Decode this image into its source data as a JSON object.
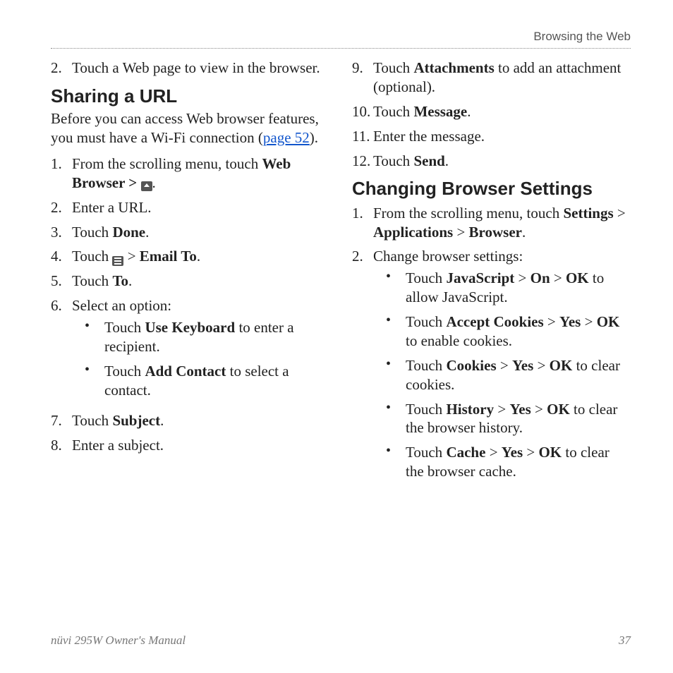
{
  "header": {
    "section": "Browsing the Web"
  },
  "footer": {
    "left": "nüvi 295W Owner's Manual",
    "right": "37"
  },
  "left_col": {
    "lead_item": {
      "n": "2.",
      "text": "Touch a Web page to view in the browser."
    },
    "h_share": "Sharing a URL",
    "share_intro_pre": "Before you can access Web browser features, you must have a Wi-Fi connection (",
    "share_intro_link": "page 52",
    "share_intro_post": ").",
    "steps": [
      {
        "n": "1.",
        "pre": "From the scrolling menu, touch ",
        "b1": "Web Browser > ",
        "icon": "home",
        "post": "."
      },
      {
        "n": "2.",
        "text": "Enter a URL."
      },
      {
        "n": "3.",
        "pre": "Touch ",
        "b1": "Done",
        "post": "."
      },
      {
        "n": "4.",
        "pre": "Touch ",
        "icon": "menu",
        "mid": " > ",
        "b1": "Email To",
        "post": "."
      },
      {
        "n": "5.",
        "pre": "Touch ",
        "b1": "To",
        "post": "."
      },
      {
        "n": "6.",
        "text": "Select an option:",
        "sub": [
          {
            "pre": "Touch ",
            "b1": "Use Keyboard",
            "post": " to enter a recipient."
          },
          {
            "pre": "Touch ",
            "b1": "Add Contact",
            "post": " to select a contact."
          }
        ]
      },
      {
        "n": "7.",
        "pre": "Touch ",
        "b1": "Subject",
        "post": "."
      },
      {
        "n": "8.",
        "text": "Enter a subject."
      }
    ]
  },
  "right_col": {
    "steps_a": [
      {
        "n": "9.",
        "pre": "Touch ",
        "b1": "Attachments",
        "post": " to add an attachment (optional)."
      },
      {
        "n": "10.",
        "pre": "Touch ",
        "b1": "Message",
        "post": "."
      },
      {
        "n": "11.",
        "text": "Enter the message."
      },
      {
        "n": "12.",
        "pre": "Touch ",
        "b1": "Send",
        "post": "."
      }
    ],
    "h_change": "Changing Browser Settings",
    "steps_b": [
      {
        "n": "1.",
        "pre": "From the scrolling menu, touch ",
        "b1": "Settings",
        "m1": " > ",
        "b2": "Applications",
        "m2": " > ",
        "b3": "Browser",
        "post": "."
      },
      {
        "n": "2.",
        "text": "Change browser settings:",
        "sub": [
          {
            "pre": "Touch ",
            "b1": "JavaScript",
            "m1": " > ",
            "b2": "On",
            "m2": " > ",
            "b3": "OK",
            "post": " to allow JavaScript."
          },
          {
            "pre": "Touch ",
            "b1": "Accept Cookies",
            "m1": " > ",
            "b2": "Yes",
            "m2": " > ",
            "b3": "OK",
            "post": " to enable cookies."
          },
          {
            "pre": "Touch ",
            "b1": "Cookies",
            "m1": " > ",
            "b2": "Yes",
            "m2": " > ",
            "b3": "OK",
            "post": " to clear cookies."
          },
          {
            "pre": "Touch ",
            "b1": "History",
            "m1": " > ",
            "b2": "Yes",
            "m2": " > ",
            "b3": "OK",
            "post": " to clear the browser history."
          },
          {
            "pre": "Touch ",
            "b1": "Cache",
            "m1": " > ",
            "b2": "Yes",
            "m2": " > ",
            "b3": "OK",
            "post": " to clear the browser cache."
          }
        ]
      }
    ]
  }
}
